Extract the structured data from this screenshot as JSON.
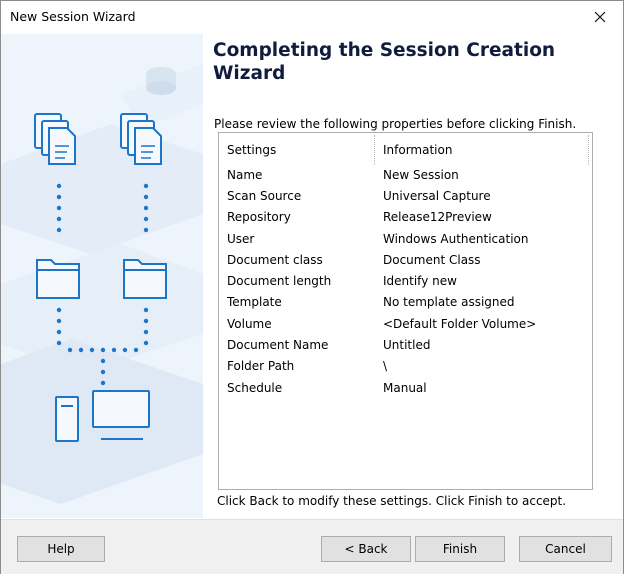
{
  "window": {
    "title": "New Session Wizard"
  },
  "heading": "Completing the Session Creation Wizard",
  "intro": "Please review the following properties before clicking Finish.",
  "table": {
    "columns": [
      "Settings",
      "Information"
    ],
    "rows": [
      [
        "Name",
        "New Session"
      ],
      [
        "Scan Source",
        "Universal Capture"
      ],
      [
        "Repository",
        "Release12Preview"
      ],
      [
        "User",
        "Windows Authentication"
      ],
      [
        "Document class",
        "Document Class"
      ],
      [
        "Document length",
        "Identify new"
      ],
      [
        "Template",
        "No template assigned"
      ],
      [
        "Volume",
        "<Default Folder Volume>"
      ],
      [
        "Document Name",
        "Untitled"
      ],
      [
        "Folder Path",
        "\\"
      ],
      [
        "Schedule",
        "Manual"
      ]
    ]
  },
  "footer_text": "Click Back to modify these settings. Click Finish to accept.",
  "buttons": {
    "help": "Help",
    "back": "< Back",
    "finish": "Finish",
    "cancel": "Cancel"
  },
  "colors": {
    "accent": "#1b75c9",
    "panel": "#eef4fb",
    "heading": "#0f1c3d"
  }
}
